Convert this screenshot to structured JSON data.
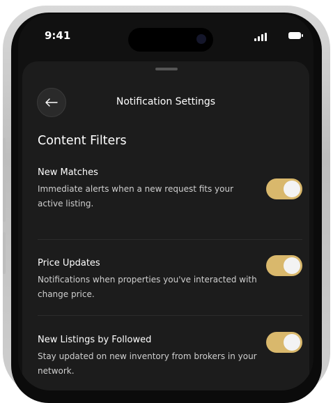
{
  "status_bar": {
    "time": "9:41",
    "icons": [
      "signal-icon",
      "battery-icon"
    ]
  },
  "header": {
    "title": "Notification Settings",
    "back_icon": "arrow-left-icon"
  },
  "section": {
    "title": "Content Filters"
  },
  "settings": [
    {
      "title": "New Matches",
      "description": "Immediate alerts when a new request fits your active listing.",
      "enabled": true
    },
    {
      "title": "Price Updates",
      "description": "Notifications when properties you've interacted with change price.",
      "enabled": true
    },
    {
      "title": "New Listings by Followed",
      "description": "Stay updated on new inventory from brokers in your network.",
      "enabled": true
    }
  ],
  "colors": {
    "accent": "#d9b86c",
    "sheet_bg": "#1c1c1c",
    "screen_bg": "#111111",
    "text_primary": "#ffffff",
    "text_secondary": "#cfcfcf"
  }
}
